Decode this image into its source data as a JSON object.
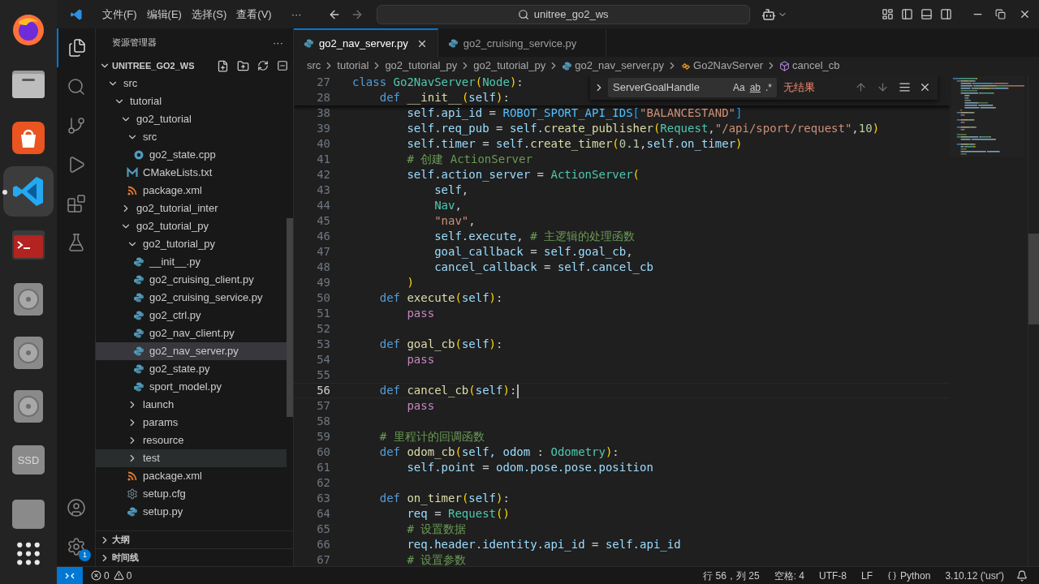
{
  "dock": {
    "items": [
      {
        "kind": "browser",
        "active": false
      },
      {
        "kind": "files",
        "active": false
      },
      {
        "kind": "store",
        "active": false
      },
      {
        "kind": "editor",
        "active": true
      },
      {
        "kind": "terminal",
        "active": false
      },
      {
        "kind": "disk",
        "active": false
      },
      {
        "kind": "disk",
        "active": false
      },
      {
        "kind": "disk",
        "active": false
      },
      {
        "kind": "drive",
        "label": "SSD",
        "active": false
      },
      {
        "kind": "drive",
        "active": false
      }
    ]
  },
  "title_bar": {
    "menus": [
      "文件(F)",
      "编辑(E)",
      "选择(S)",
      "查看(V)"
    ],
    "more": "···",
    "search": "unitree_go2_ws"
  },
  "activity_bar": {
    "items": [
      {
        "kind": "explorer",
        "selected": true
      },
      {
        "kind": "search",
        "selected": false
      },
      {
        "kind": "source-control",
        "selected": false
      },
      {
        "kind": "run",
        "selected": false
      },
      {
        "kind": "extensions",
        "selected": false
      },
      {
        "kind": "testing",
        "selected": false
      }
    ],
    "bottom": [
      {
        "kind": "accounts"
      },
      {
        "kind": "manage",
        "badge": "1"
      }
    ]
  },
  "sidebar": {
    "title": "资源管理器",
    "more": "···",
    "root": {
      "name": "UNITREE_GO2_WS",
      "expanded": true
    },
    "tree": [
      {
        "name": "src",
        "kind": "folder",
        "expanded": true,
        "selected": false,
        "hovered": false,
        "children": [
          {
            "name": "tutorial",
            "kind": "folder",
            "expanded": true,
            "selected": false,
            "hovered": false,
            "children": [
              {
                "name": "go2_tutorial",
                "kind": "folder",
                "expanded": true,
                "selected": false,
                "hovered": false,
                "children": [
                  {
                    "name": "src",
                    "kind": "folder",
                    "expanded": true,
                    "selected": false,
                    "hovered": false,
                    "children": [
                      {
                        "name": "go2_state.cpp",
                        "kind": "cpp",
                        "selected": false,
                        "hovered": false
                      }
                    ]
                  },
                  {
                    "name": "CMakeLists.txt",
                    "kind": "cmake",
                    "selected": false,
                    "hovered": false
                  },
                  {
                    "name": "package.xml",
                    "kind": "xml",
                    "selected": false,
                    "hovered": false
                  }
                ]
              },
              {
                "name": "go2_tutorial_inter",
                "kind": "folder",
                "expanded": false,
                "selected": false,
                "hovered": false
              },
              {
                "name": "go2_tutorial_py",
                "kind": "folder",
                "expanded": true,
                "selected": false,
                "hovered": false,
                "children": [
                  {
                    "name": "go2_tutorial_py",
                    "kind": "folder",
                    "expanded": true,
                    "selected": false,
                    "hovered": false,
                    "children": [
                      {
                        "name": "__init__.py",
                        "kind": "python",
                        "selected": false,
                        "hovered": false
                      },
                      {
                        "name": "go2_cruising_client.py",
                        "kind": "python",
                        "selected": false,
                        "hovered": false
                      },
                      {
                        "name": "go2_cruising_service.py",
                        "kind": "python",
                        "selected": false,
                        "hovered": false
                      },
                      {
                        "name": "go2_ctrl.py",
                        "kind": "python",
                        "selected": false,
                        "hovered": false
                      },
                      {
                        "name": "go2_nav_client.py",
                        "kind": "python",
                        "selected": false,
                        "hovered": false
                      },
                      {
                        "name": "go2_nav_server.py",
                        "kind": "python",
                        "selected": true,
                        "hovered": false
                      },
                      {
                        "name": "go2_state.py",
                        "kind": "python",
                        "selected": false,
                        "hovered": false
                      },
                      {
                        "name": "sport_model.py",
                        "kind": "python",
                        "selected": false,
                        "hovered": false
                      }
                    ]
                  },
                  {
                    "name": "launch",
                    "kind": "folder",
                    "expanded": false,
                    "selected": false,
                    "hovered": false
                  },
                  {
                    "name": "params",
                    "kind": "folder",
                    "expanded": false,
                    "selected": false,
                    "hovered": false
                  },
                  {
                    "name": "resource",
                    "kind": "folder",
                    "expanded": false,
                    "selected": false,
                    "hovered": false
                  },
                  {
                    "name": "test",
                    "kind": "folder",
                    "expanded": false,
                    "selected": false,
                    "hovered": true
                  },
                  {
                    "name": "package.xml",
                    "kind": "xml",
                    "selected": false,
                    "hovered": false
                  },
                  {
                    "name": "setup.cfg",
                    "kind": "config",
                    "selected": false,
                    "hovered": false
                  },
                  {
                    "name": "setup.py",
                    "kind": "python",
                    "selected": false,
                    "hovered": false
                  }
                ]
              }
            ]
          }
        ]
      }
    ],
    "sections": [
      {
        "name": "大纲",
        "expanded": false
      },
      {
        "name": "时间线",
        "expanded": false
      }
    ]
  },
  "editor": {
    "tabs": [
      {
        "name": "go2_nav_server.py",
        "selected": true
      },
      {
        "name": "go2_cruising_service.py",
        "selected": false
      }
    ],
    "breadcrumb": [
      {
        "text": "src",
        "kind": "folder"
      },
      {
        "text": "tutorial",
        "kind": "folder"
      },
      {
        "text": "go2_tutorial_py",
        "kind": "folder"
      },
      {
        "text": "go2_tutorial_py",
        "kind": "folder"
      },
      {
        "text": "go2_nav_server.py",
        "kind": "file"
      },
      {
        "text": "Go2NavServer",
        "kind": "class"
      },
      {
        "text": "cancel_cb",
        "kind": "method"
      }
    ],
    "find": {
      "query": "ServerGoalHandle",
      "options": [
        "Aa",
        "ab",
        ".*"
      ],
      "result": "无结果"
    },
    "sticky_lines": [
      {
        "number": "27",
        "tokens": [
          {
            "kind": "keyword",
            "text": "class "
          },
          {
            "kind": "type",
            "text": "Go2NavServer"
          },
          {
            "kind": "paren",
            "text": "("
          },
          {
            "kind": "type",
            "text": "Node"
          },
          {
            "kind": "paren",
            "text": ")"
          },
          {
            "kind": "plain",
            "text": ":"
          }
        ]
      },
      {
        "number": "28",
        "tokens": [
          {
            "kind": "keyword",
            "text": "    def "
          },
          {
            "kind": "function",
            "text": "__init__"
          },
          {
            "kind": "paren",
            "text": "("
          },
          {
            "kind": "variable",
            "text": "self"
          },
          {
            "kind": "paren",
            "text": ")"
          },
          {
            "kind": "plain",
            "text": ":"
          }
        ]
      }
    ],
    "lines": [
      {
        "number": "38",
        "current": false,
        "tokens": [
          {
            "kind": "variable",
            "text": "        self.api_id"
          },
          {
            "kind": "plain",
            "text": " = "
          },
          {
            "kind": "constant",
            "text": "ROBOT_SPORT_API_IDS"
          },
          {
            "kind": "bracket",
            "text": "["
          },
          {
            "kind": "string",
            "text": "\"BALANCESTAND\""
          },
          {
            "kind": "bracket",
            "text": "]"
          }
        ]
      },
      {
        "number": "39",
        "current": false,
        "tokens": [
          {
            "kind": "variable",
            "text": "        self.req_pub"
          },
          {
            "kind": "plain",
            "text": " = "
          },
          {
            "kind": "variable",
            "text": "self."
          },
          {
            "kind": "function",
            "text": "create_publisher"
          },
          {
            "kind": "paren",
            "text": "("
          },
          {
            "kind": "type",
            "text": "Request"
          },
          {
            "kind": "plain",
            "text": ","
          },
          {
            "kind": "string",
            "text": "\"/api/sport/request\""
          },
          {
            "kind": "plain",
            "text": ","
          },
          {
            "kind": "number",
            "text": "10"
          },
          {
            "kind": "paren",
            "text": ")"
          }
        ]
      },
      {
        "number": "40",
        "current": false,
        "tokens": [
          {
            "kind": "variable",
            "text": "        self.timer"
          },
          {
            "kind": "plain",
            "text": " = "
          },
          {
            "kind": "variable",
            "text": "self."
          },
          {
            "kind": "function",
            "text": "create_timer"
          },
          {
            "kind": "paren",
            "text": "("
          },
          {
            "kind": "number",
            "text": "0.1"
          },
          {
            "kind": "plain",
            "text": ","
          },
          {
            "kind": "variable",
            "text": "self.on_timer"
          },
          {
            "kind": "paren",
            "text": ")"
          }
        ]
      },
      {
        "number": "41",
        "current": false,
        "tokens": [
          {
            "kind": "comment",
            "text": "        # 创建 ActionServer"
          }
        ]
      },
      {
        "number": "42",
        "current": false,
        "tokens": [
          {
            "kind": "variable",
            "text": "        self.action_server"
          },
          {
            "kind": "plain",
            "text": " = "
          },
          {
            "kind": "type",
            "text": "ActionServer"
          },
          {
            "kind": "paren",
            "text": "("
          }
        ]
      },
      {
        "number": "43",
        "current": false,
        "tokens": [
          {
            "kind": "variable",
            "text": "            self"
          },
          {
            "kind": "plain",
            "text": ","
          }
        ]
      },
      {
        "number": "44",
        "current": false,
        "tokens": [
          {
            "kind": "type",
            "text": "            Nav"
          },
          {
            "kind": "plain",
            "text": ","
          }
        ]
      },
      {
        "number": "45",
        "current": false,
        "tokens": [
          {
            "kind": "string",
            "text": "            \"nav\""
          },
          {
            "kind": "plain",
            "text": ","
          }
        ]
      },
      {
        "number": "46",
        "current": false,
        "tokens": [
          {
            "kind": "variable",
            "text": "            self.execute"
          },
          {
            "kind": "plain",
            "text": ", "
          },
          {
            "kind": "comment",
            "text": "# 主逻辑的处理函数"
          }
        ]
      },
      {
        "number": "47",
        "current": false,
        "tokens": [
          {
            "kind": "variable",
            "text": "            goal_callback"
          },
          {
            "kind": "plain",
            "text": " = "
          },
          {
            "kind": "variable",
            "text": "self.goal_cb"
          },
          {
            "kind": "plain",
            "text": ","
          }
        ]
      },
      {
        "number": "48",
        "current": false,
        "tokens": [
          {
            "kind": "variable",
            "text": "            cancel_callback"
          },
          {
            "kind": "plain",
            "text": " = "
          },
          {
            "kind": "variable",
            "text": "self.cancel_cb"
          }
        ]
      },
      {
        "number": "49",
        "current": false,
        "tokens": [
          {
            "kind": "paren",
            "text": "        )"
          }
        ]
      },
      {
        "number": "50",
        "current": false,
        "tokens": [
          {
            "kind": "keyword",
            "text": "    def "
          },
          {
            "kind": "function",
            "text": "execute"
          },
          {
            "kind": "paren",
            "text": "("
          },
          {
            "kind": "variable",
            "text": "self"
          },
          {
            "kind": "paren",
            "text": ")"
          },
          {
            "kind": "plain",
            "text": ":"
          }
        ]
      },
      {
        "number": "51",
        "current": false,
        "tokens": [
          {
            "kind": "control",
            "text": "        pass"
          }
        ]
      },
      {
        "number": "52",
        "current": false
      },
      {
        "number": "53",
        "current": false,
        "tokens": [
          {
            "kind": "keyword",
            "text": "    def "
          },
          {
            "kind": "function",
            "text": "goal_cb"
          },
          {
            "kind": "paren",
            "text": "("
          },
          {
            "kind": "variable",
            "text": "self"
          },
          {
            "kind": "paren",
            "text": ")"
          },
          {
            "kind": "plain",
            "text": ":"
          }
        ]
      },
      {
        "number": "54",
        "current": false,
        "tokens": [
          {
            "kind": "control",
            "text": "        pass"
          }
        ]
      },
      {
        "number": "55",
        "current": false
      },
      {
        "number": "56",
        "current": true,
        "tokens": [
          {
            "kind": "keyword",
            "text": "    def "
          },
          {
            "kind": "function",
            "text": "cancel_cb"
          },
          {
            "kind": "paren",
            "text": "("
          },
          {
            "kind": "variable",
            "text": "self"
          },
          {
            "kind": "paren",
            "text": ")"
          },
          {
            "kind": "plain",
            "text": ":"
          }
        ]
      },
      {
        "number": "57",
        "current": false,
        "tokens": [
          {
            "kind": "control",
            "text": "        pass"
          }
        ]
      },
      {
        "number": "58",
        "current": false
      },
      {
        "number": "59",
        "current": false,
        "tokens": [
          {
            "kind": "comment",
            "text": "    # 里程计的回调函数"
          }
        ]
      },
      {
        "number": "60",
        "current": false,
        "tokens": [
          {
            "kind": "keyword",
            "text": "    def "
          },
          {
            "kind": "function",
            "text": "odom_cb"
          },
          {
            "kind": "paren",
            "text": "("
          },
          {
            "kind": "variable",
            "text": "self, odom"
          },
          {
            "kind": "plain",
            "text": " : "
          },
          {
            "kind": "type",
            "text": "Odometry"
          },
          {
            "kind": "paren",
            "text": ")"
          },
          {
            "kind": "plain",
            "text": ":"
          }
        ]
      },
      {
        "number": "61",
        "current": false,
        "tokens": [
          {
            "kind": "variable",
            "text": "        self.point"
          },
          {
            "kind": "plain",
            "text": " = "
          },
          {
            "kind": "variable",
            "text": "odom.pose.pose.position"
          }
        ]
      },
      {
        "number": "62",
        "current": false
      },
      {
        "number": "63",
        "current": false,
        "tokens": [
          {
            "kind": "keyword",
            "text": "    def "
          },
          {
            "kind": "function",
            "text": "on_timer"
          },
          {
            "kind": "paren",
            "text": "("
          },
          {
            "kind": "variable",
            "text": "self"
          },
          {
            "kind": "paren",
            "text": ")"
          },
          {
            "kind": "plain",
            "text": ":"
          }
        ]
      },
      {
        "number": "64",
        "current": false,
        "tokens": [
          {
            "kind": "variable",
            "text": "        req"
          },
          {
            "kind": "plain",
            "text": " = "
          },
          {
            "kind": "type",
            "text": "Request"
          },
          {
            "kind": "paren",
            "text": "()"
          }
        ]
      },
      {
        "number": "65",
        "current": false,
        "tokens": [
          {
            "kind": "comment",
            "text": "        # 设置数据"
          }
        ]
      },
      {
        "number": "66",
        "current": false,
        "tokens": [
          {
            "kind": "variable",
            "text": "        req.header.identity.api_id"
          },
          {
            "kind": "plain",
            "text": " = "
          },
          {
            "kind": "variable",
            "text": "self.api_id"
          }
        ]
      },
      {
        "number": "67",
        "current": false,
        "tokens": [
          {
            "kind": "comment",
            "text": "        # 设置参数"
          }
        ]
      }
    ]
  },
  "status_bar": {
    "errors": "0",
    "warnings": "0",
    "items": [
      {
        "text": "行 56，列 25",
        "kind": "text"
      },
      {
        "text": "空格: 4",
        "kind": "text"
      },
      {
        "text": "UTF-8",
        "kind": "text"
      },
      {
        "text": "LF",
        "kind": "text"
      },
      {
        "text": "Python",
        "kind": "language"
      },
      {
        "text": "3.10.12 ('usr')",
        "kind": "text"
      }
    ]
  }
}
